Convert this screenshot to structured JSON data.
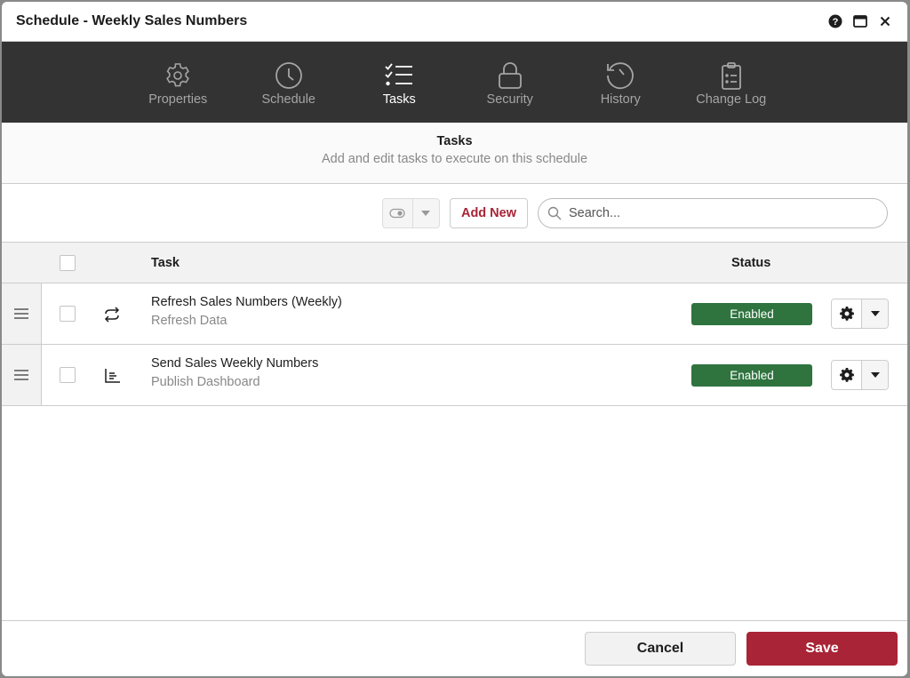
{
  "window": {
    "title": "Schedule - Weekly Sales Numbers",
    "icons": [
      "help-icon",
      "maximize-icon",
      "close-icon"
    ]
  },
  "nav": {
    "tabs": [
      {
        "label": "Properties",
        "icon": "gear-icon",
        "active": false
      },
      {
        "label": "Schedule",
        "icon": "clock-icon",
        "active": false
      },
      {
        "label": "Tasks",
        "icon": "checklist-icon",
        "active": true
      },
      {
        "label": "Security",
        "icon": "lock-icon",
        "active": false
      },
      {
        "label": "History",
        "icon": "history-icon",
        "active": false
      },
      {
        "label": "Change Log",
        "icon": "clipboard-list-icon",
        "active": false
      }
    ]
  },
  "section": {
    "title": "Tasks",
    "subtitle": "Add and edit tasks to execute on this schedule"
  },
  "toolbar": {
    "add_new_label": "Add New",
    "search_placeholder": "Search..."
  },
  "table": {
    "columns": {
      "task": "Task",
      "status": "Status"
    },
    "rows": [
      {
        "name": "Refresh Sales Numbers (Weekly)",
        "type": "Refresh Data",
        "icon": "refresh-icon",
        "status": "Enabled"
      },
      {
        "name": "Send Sales Weekly Numbers",
        "type": "Publish Dashboard",
        "icon": "dashboard-icon",
        "status": "Enabled"
      }
    ]
  },
  "footer": {
    "cancel_label": "Cancel",
    "save_label": "Save"
  },
  "colors": {
    "accent": "#a82436",
    "nav_bg": "#333333",
    "status_enabled": "#2f733f"
  }
}
